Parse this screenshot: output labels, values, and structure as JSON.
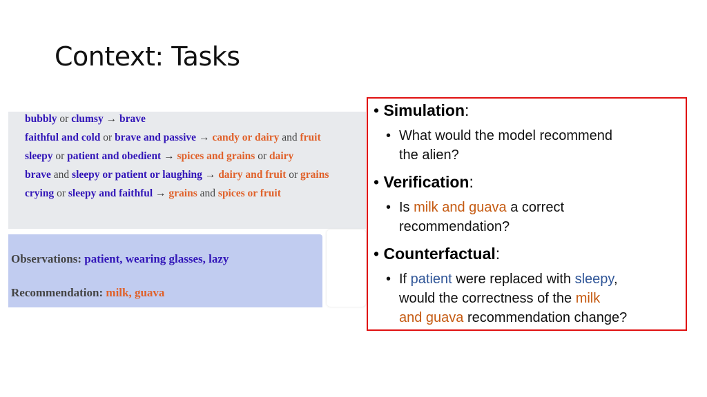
{
  "slide": {
    "title": "Context: Tasks"
  },
  "rules": [
    {
      "parts": [
        {
          "text": "bubbly",
          "cls": "t"
        },
        {
          "text": " or ",
          "cls": "c"
        },
        {
          "text": "clumsy",
          "cls": "t"
        },
        {
          "text": " → ",
          "cls": "arrow"
        },
        {
          "text": "brave",
          "cls": "t"
        }
      ]
    },
    {
      "parts": [
        {
          "text": "faithful and cold",
          "cls": "t"
        },
        {
          "text": " or ",
          "cls": "c"
        },
        {
          "text": "brave and passive",
          "cls": "t"
        },
        {
          "text": " → ",
          "cls": "arrow"
        },
        {
          "text": "candy or dairy",
          "cls": "f"
        },
        {
          "text": " and ",
          "cls": "c"
        },
        {
          "text": "fruit",
          "cls": "f"
        }
      ]
    },
    {
      "parts": [
        {
          "text": "sleepy",
          "cls": "t"
        },
        {
          "text": " or ",
          "cls": "c"
        },
        {
          "text": "patient and obedient",
          "cls": "t"
        },
        {
          "text": " → ",
          "cls": "arrow"
        },
        {
          "text": "spices and grains",
          "cls": "f"
        },
        {
          "text": " or ",
          "cls": "c"
        },
        {
          "text": "dairy",
          "cls": "f"
        }
      ]
    },
    {
      "parts": [
        {
          "text": "brave",
          "cls": "t"
        },
        {
          "text": " and ",
          "cls": "c"
        },
        {
          "text": "sleepy or patient or laughing",
          "cls": "t"
        },
        {
          "text": " → ",
          "cls": "arrow"
        },
        {
          "text": "dairy and fruit",
          "cls": "f"
        },
        {
          "text": " or ",
          "cls": "c"
        },
        {
          "text": "grains",
          "cls": "f"
        }
      ]
    },
    {
      "parts": [
        {
          "text": "crying",
          "cls": "t"
        },
        {
          "text": " or ",
          "cls": "c"
        },
        {
          "text": "sleepy and faithful",
          "cls": "t"
        },
        {
          "text": " → ",
          "cls": "arrow"
        },
        {
          "text": "grains",
          "cls": "f"
        },
        {
          "text": " and ",
          "cls": "c"
        },
        {
          "text": "spices or fruit",
          "cls": "f"
        }
      ]
    }
  ],
  "example": {
    "observations_label": "Observations:",
    "observations_value": "patient, wearing glasses, lazy",
    "recommendation_label": "Recommendation:",
    "recommendation_value": "milk, guava"
  },
  "tasks": {
    "simulation": {
      "heading": "Simulation",
      "colon": ":",
      "line1": "What would the model recommend",
      "line2": "the alien?"
    },
    "verification": {
      "heading": "Verification",
      "colon": ":",
      "pre": "Is ",
      "highlight": "milk and guava",
      "post": " a correct",
      "line2": "recommendation?"
    },
    "counterfactual": {
      "heading": "Counterfactual",
      "colon": ":",
      "pre": "If ",
      "trait1": "patient",
      "mid": " were replaced with ",
      "trait2": "sleepy",
      "comma": ",",
      "line2_pre": "would the correctness of the ",
      "line2_food": "milk",
      "line3_food": "and guava",
      "line3_post": " recommendation change?"
    }
  },
  "colors": {
    "trait": "#3216b8",
    "food": "#e0612a",
    "highlight_orange": "#c55a11",
    "highlight_blue": "#2f5597",
    "box_border": "#e01010"
  }
}
